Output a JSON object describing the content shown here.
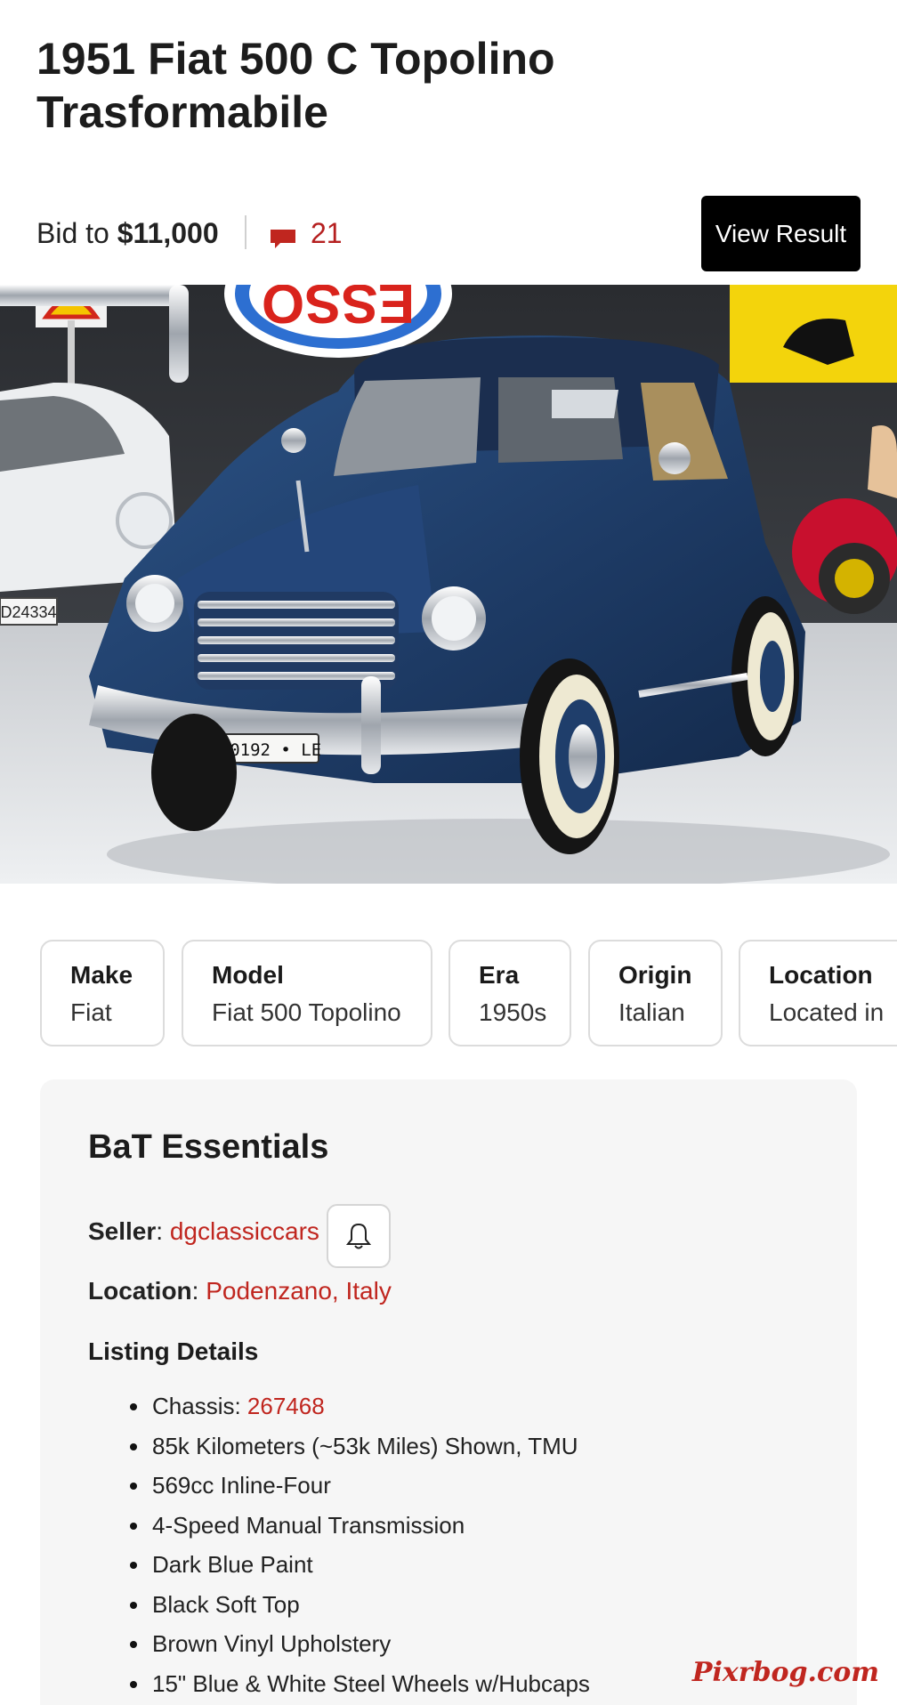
{
  "listing": {
    "title": "1951 Fiat 500 C Topolino Trasformabile",
    "bid_prefix": "Bid to",
    "bid_amount": "$11,000",
    "comment_count": "21",
    "view_result_label": "View Result"
  },
  "hero": {
    "signs": [
      "ESSO"
    ],
    "plate_right": "30192 • LE",
    "plate_left": "D24334"
  },
  "chips": [
    {
      "key": "Make",
      "value": "Fiat"
    },
    {
      "key": "Model",
      "value": "Fiat 500 Topolino"
    },
    {
      "key": "Era",
      "value": "1950s"
    },
    {
      "key": "Origin",
      "value": "Italian"
    },
    {
      "key": "Location",
      "value": "Located in"
    }
  ],
  "essentials": {
    "title": "BaT Essentials",
    "seller_label": "Seller",
    "seller_value": "dgclassiccars",
    "location_label": "Location",
    "location_value": "Podenzano, Italy",
    "details_title": "Listing Details",
    "chassis_label": "Chassis: ",
    "chassis_value": "267468",
    "details": [
      "85k Kilometers (~53k Miles) Shown, TMU",
      "569cc Inline-Four",
      "4-Speed Manual Transmission",
      "Dark Blue Paint",
      "Black Soft Top",
      "Brown Vinyl Upholstery",
      "15\" Blue & White Steel Wheels w/Hubcaps"
    ]
  },
  "watermark": "Pixrbog.com",
  "colors": {
    "accent": "#c0261f",
    "car_body": "#1f3e6b",
    "button_bg": "#000000"
  },
  "icons": [
    "comment-icon",
    "bell-icon"
  ]
}
